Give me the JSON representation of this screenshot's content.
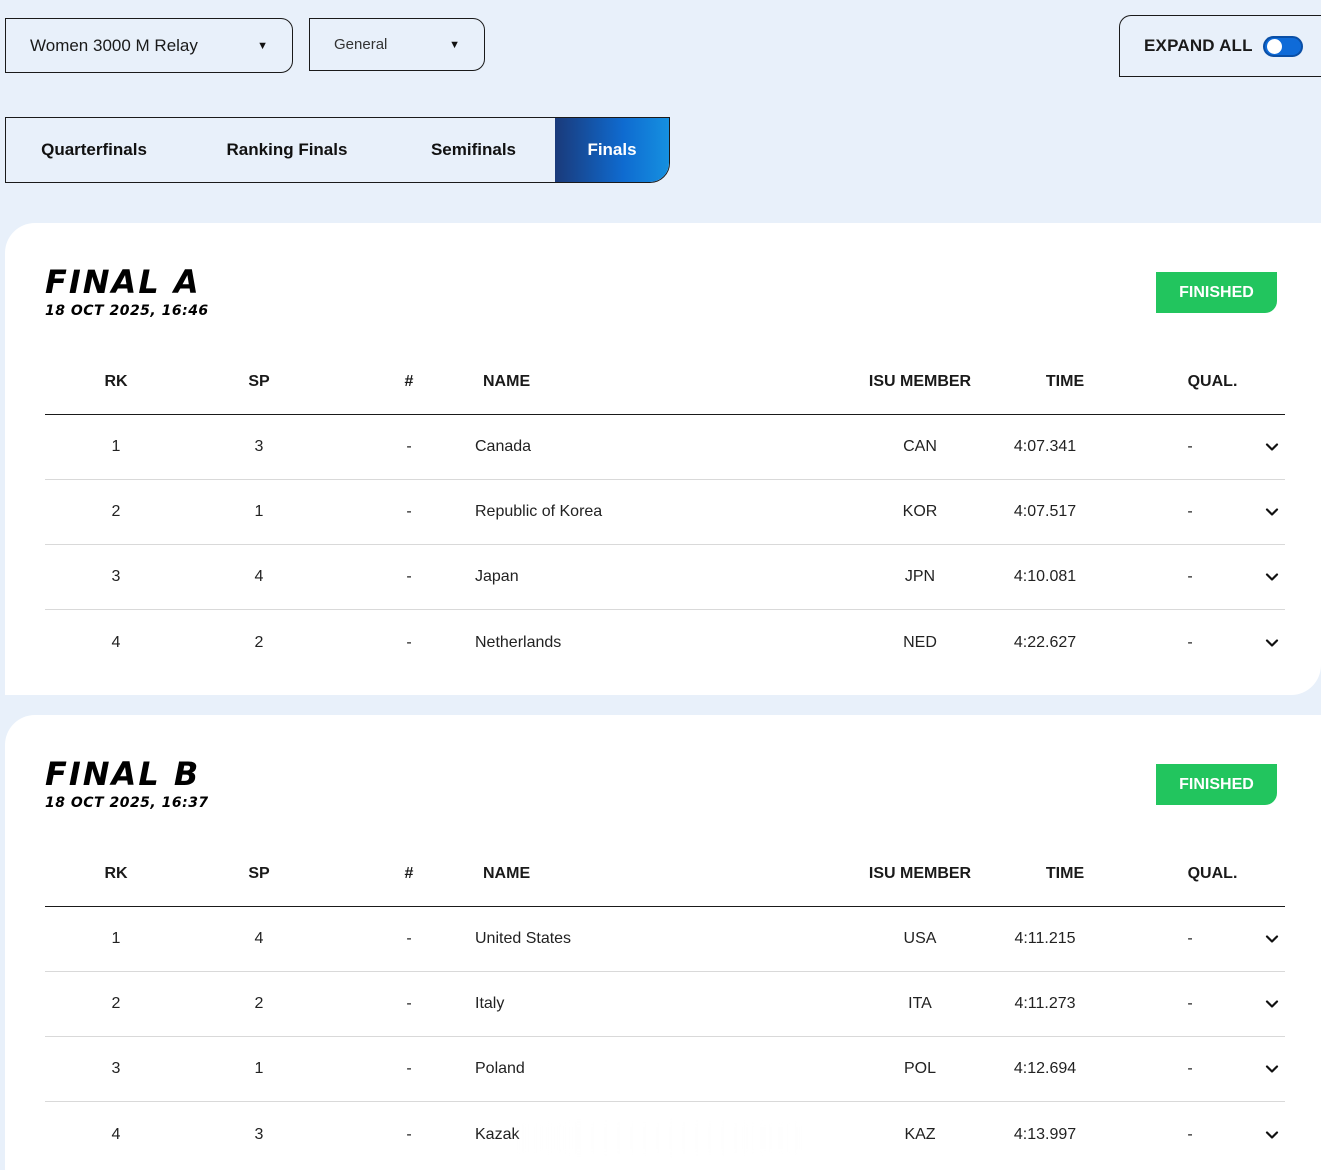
{
  "filters": {
    "event": "Women 3000 M Relay",
    "category": "General",
    "expand_all_label": "EXPAND ALL",
    "expand_all_on": true
  },
  "rounds": [
    "Quarterfinals",
    "Ranking Finals",
    "Semifinals",
    "Finals"
  ],
  "active_round": "Finals",
  "columns": {
    "rk": "RK",
    "sp": "SP",
    "num": "#",
    "name": "NAME",
    "isu": "ISU MEMBER",
    "time": "TIME",
    "qual": "QUAL."
  },
  "heats": [
    {
      "title": "FINAL A",
      "datetime": "18 OCT 2025, 16:46",
      "status": "FINISHED",
      "rows": [
        {
          "rk": "1",
          "sp": "3",
          "num": "-",
          "name": "Canada",
          "isu": "CAN",
          "time": "4:07.341",
          "qual": "-"
        },
        {
          "rk": "2",
          "sp": "1",
          "num": "-",
          "name": "Republic of Korea",
          "isu": "KOR",
          "time": "4:07.517",
          "qual": "-"
        },
        {
          "rk": "3",
          "sp": "4",
          "num": "-",
          "name": "Japan",
          "isu": "JPN",
          "time": "4:10.081",
          "qual": "-"
        },
        {
          "rk": "4",
          "sp": "2",
          "num": "-",
          "name": "Netherlands",
          "isu": "NED",
          "time": "4:22.627",
          "qual": "-"
        }
      ]
    },
    {
      "title": "FINAL B",
      "datetime": "18 OCT 2025, 16:37",
      "status": "FINISHED",
      "rows": [
        {
          "rk": "1",
          "sp": "4",
          "num": "-",
          "name": "United States",
          "isu": "USA",
          "time": "4:11.215",
          "qual": "-"
        },
        {
          "rk": "2",
          "sp": "2",
          "num": "-",
          "name": "Italy",
          "isu": "ITA",
          "time": "4:11.273",
          "qual": "-"
        },
        {
          "rk": "3",
          "sp": "1",
          "num": "-",
          "name": "Poland",
          "isu": "POL",
          "time": "4:12.694",
          "qual": "-"
        },
        {
          "rk": "4",
          "sp": "3",
          "num": "-",
          "name": "Kazak",
          "isu": "KAZ",
          "time": "4:13.997",
          "qual": "-"
        }
      ]
    }
  ],
  "colors": {
    "page_bg": "#e8f0fa",
    "status_green": "#22c55e",
    "toggle_blue": "#0f6bd8",
    "tab_active_start": "#1a3a7a",
    "tab_active_end": "#1590e0"
  }
}
